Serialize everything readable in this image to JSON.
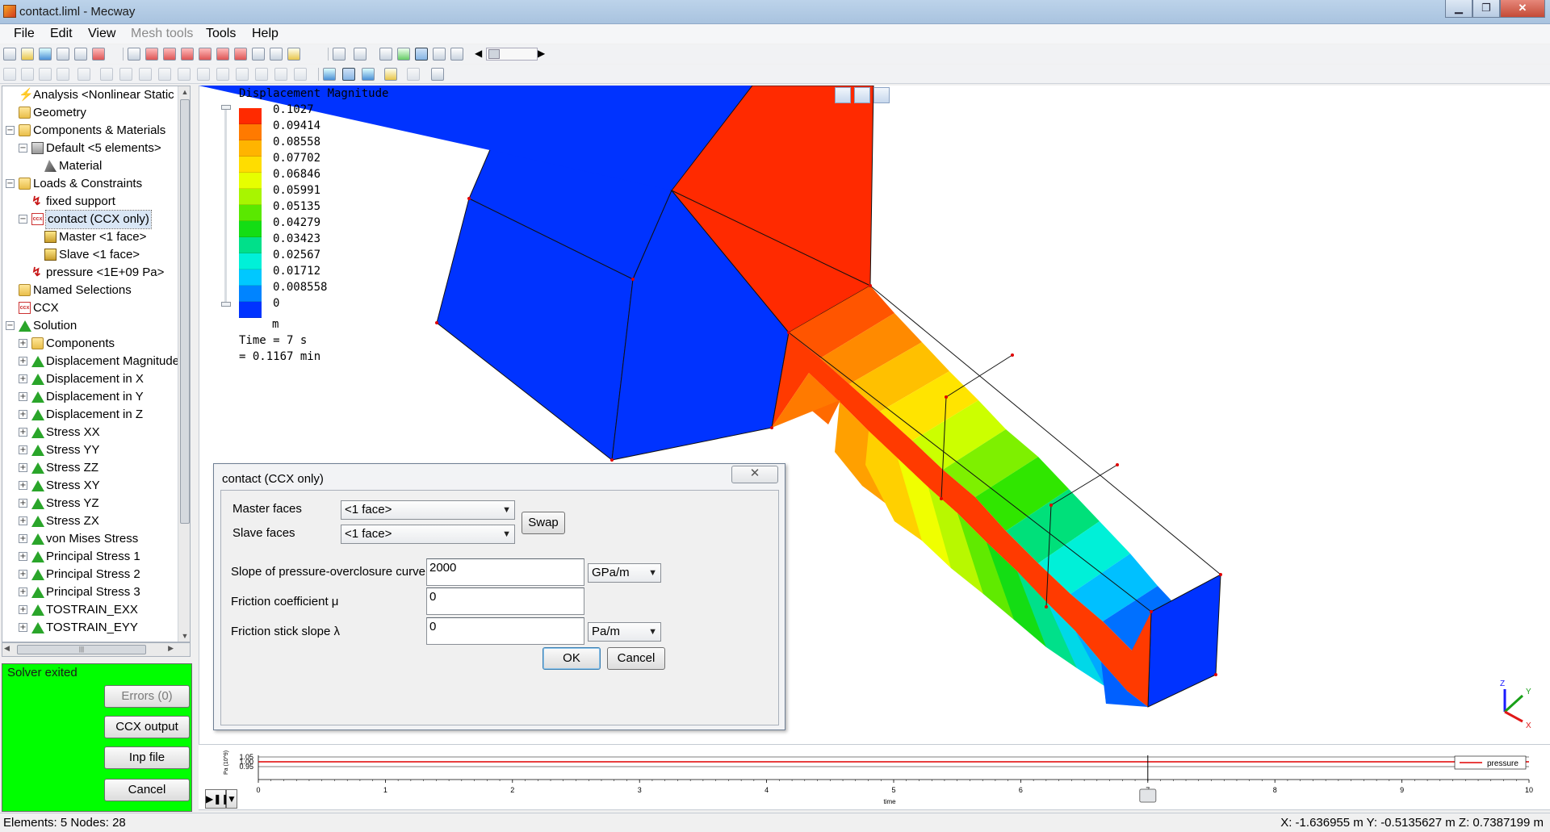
{
  "window": {
    "title": "contact.liml - Mecway"
  },
  "menu": [
    "File",
    "Edit",
    "View",
    "Mesh tools",
    "Tools",
    "Help"
  ],
  "tree": [
    {
      "label": "Analysis <Nonlinear Static",
      "icon": "bolt-icon",
      "level": 0,
      "exp": ""
    },
    {
      "label": "Geometry",
      "icon": "folder-icon",
      "level": 0,
      "exp": ""
    },
    {
      "label": "Components & Materials",
      "icon": "folder-icon",
      "level": 0,
      "exp": "−"
    },
    {
      "label": "Default <5 elements>",
      "icon": "component-icon",
      "level": 1,
      "exp": "−"
    },
    {
      "label": "Material",
      "icon": "material-icon",
      "level": 2,
      "exp": ""
    },
    {
      "label": "Loads & Constraints",
      "icon": "folder-icon",
      "level": 0,
      "exp": "−"
    },
    {
      "label": "fixed support",
      "icon": "load-icon",
      "level": 1,
      "exp": ""
    },
    {
      "label": "contact (CCX only)",
      "icon": "ccx-icon",
      "level": 1,
      "exp": "−",
      "selected": true
    },
    {
      "label": "Master <1 face>",
      "icon": "face-icon",
      "level": 2,
      "exp": ""
    },
    {
      "label": "Slave <1 face>",
      "icon": "face-icon",
      "level": 2,
      "exp": ""
    },
    {
      "label": "pressure <1E+09 Pa>",
      "icon": "load-icon",
      "level": 1,
      "exp": ""
    },
    {
      "label": "Named Selections",
      "icon": "folder-icon",
      "level": 0,
      "exp": ""
    },
    {
      "label": "CCX",
      "icon": "ccx-icon",
      "level": 0,
      "exp": ""
    },
    {
      "label": "Solution",
      "icon": "result-icon",
      "level": 0,
      "exp": "−"
    },
    {
      "label": "Components",
      "icon": "folder-icon",
      "level": 1,
      "exp": "+"
    },
    {
      "label": "Displacement Magnitude",
      "icon": "result-icon",
      "level": 1,
      "exp": "+"
    },
    {
      "label": "Displacement in X",
      "icon": "result-icon",
      "level": 1,
      "exp": "+"
    },
    {
      "label": "Displacement in Y",
      "icon": "result-icon",
      "level": 1,
      "exp": "+"
    },
    {
      "label": "Displacement in Z",
      "icon": "result-icon",
      "level": 1,
      "exp": "+"
    },
    {
      "label": "Stress XX",
      "icon": "result-icon",
      "level": 1,
      "exp": "+"
    },
    {
      "label": "Stress YY",
      "icon": "result-icon",
      "level": 1,
      "exp": "+"
    },
    {
      "label": "Stress ZZ",
      "icon": "result-icon",
      "level": 1,
      "exp": "+"
    },
    {
      "label": "Stress XY",
      "icon": "result-icon",
      "level": 1,
      "exp": "+"
    },
    {
      "label": "Stress YZ",
      "icon": "result-icon",
      "level": 1,
      "exp": "+"
    },
    {
      "label": "Stress ZX",
      "icon": "result-icon",
      "level": 1,
      "exp": "+"
    },
    {
      "label": "von Mises Stress",
      "icon": "result-icon",
      "level": 1,
      "exp": "+"
    },
    {
      "label": "Principal Stress 1",
      "icon": "result-icon",
      "level": 1,
      "exp": "+"
    },
    {
      "label": "Principal Stress 2",
      "icon": "result-icon",
      "level": 1,
      "exp": "+"
    },
    {
      "label": "Principal Stress 3",
      "icon": "result-icon",
      "level": 1,
      "exp": "+"
    },
    {
      "label": "TOSTRAIN_EXX",
      "icon": "result-icon",
      "level": 1,
      "exp": "+"
    },
    {
      "label": "TOSTRAIN_EYY",
      "icon": "result-icon",
      "level": 1,
      "exp": "+"
    }
  ],
  "solver": {
    "status": "Solver exited",
    "errors_label": "Errors (0)",
    "ccx_output_label": "CCX output",
    "inp_file_label": "Inp file",
    "cancel_label": "Cancel"
  },
  "legend": {
    "title": "Displacement Magnitude",
    "values": [
      "0.1027",
      "0.09414",
      "0.08558",
      "0.07702",
      "0.06846",
      "0.05991",
      "0.05135",
      "0.04279",
      "0.03423",
      "0.02567",
      "0.01712",
      "0.008558",
      "0"
    ],
    "colors": [
      "#ff2a00",
      "#ff7a00",
      "#ffb400",
      "#ffdd00",
      "#e6ff00",
      "#a8f500",
      "#5ae800",
      "#14dd14",
      "#00e08a",
      "#00f0d8",
      "#00c8ff",
      "#0084ff",
      "#0033ff"
    ],
    "unit": "m",
    "time_line1": "Time = 7 s",
    "time_line2": "= 0.1167 min"
  },
  "dialog": {
    "title": "contact (CCX only)",
    "close_glyph": "✕",
    "master_label": "Master faces",
    "master_value": "<1 face>",
    "slave_label": "Slave faces",
    "slave_value": "<1 face>",
    "swap_label": "Swap",
    "slope_label": "Slope of pressure-overclosure curve K",
    "slope_value": "2000",
    "slope_unit": "GPa/m",
    "friction_label": "Friction coefficient μ",
    "friction_value": "0",
    "stick_label": "Friction stick slope λ",
    "stick_value": "0",
    "stick_unit": "Pa/m",
    "ok_label": "OK",
    "cancel_label": "Cancel"
  },
  "timeline": {
    "ylabel": "Pa (10^9)",
    "yticks": [
      "1.05",
      "1.00",
      "0.95"
    ],
    "xticks": [
      "0",
      "1",
      "2",
      "3",
      "4",
      "5",
      "6",
      "7",
      "8",
      "9",
      "10"
    ],
    "xlabel": "time",
    "legend": "pressure",
    "current_time": 7
  },
  "status": {
    "left": "Elements:  5    Nodes: 28",
    "right": "X: -1.636955 m Y: -0.5135627 m Z: 0.7387199 m"
  },
  "axes": {
    "x": "X",
    "y": "Y",
    "z": "Z"
  }
}
